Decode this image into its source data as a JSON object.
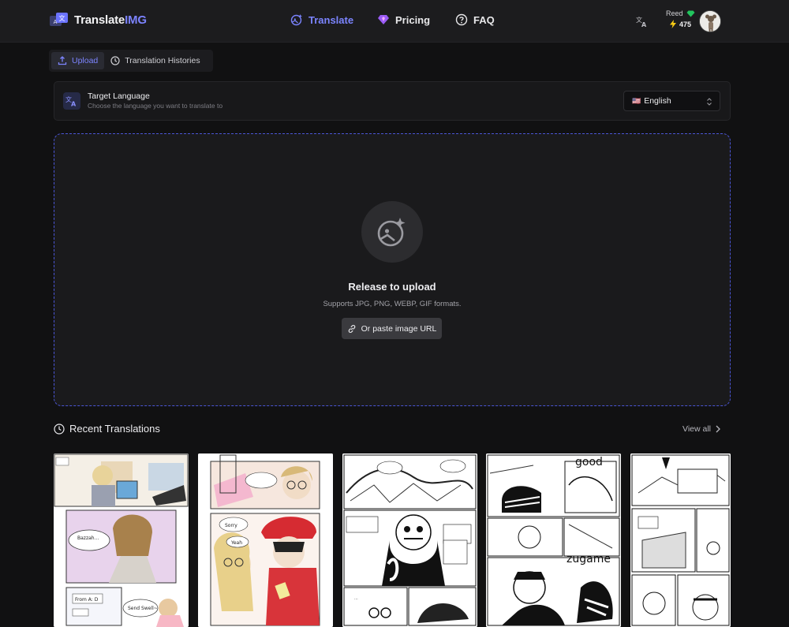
{
  "header": {
    "logo_text": "Translate",
    "logo_accent": "IMG",
    "nav": [
      {
        "label": "Translate",
        "icon": "sparkle-image-icon",
        "active": true
      },
      {
        "label": "Pricing",
        "icon": "diamond-icon",
        "active": false
      },
      {
        "label": "FAQ",
        "icon": "question-circle-icon",
        "active": false
      }
    ],
    "user": {
      "name": "Reed",
      "credits": "475"
    }
  },
  "tabs": [
    {
      "label": "Upload",
      "icon": "upload-icon",
      "active": true
    },
    {
      "label": "Translation Histories",
      "icon": "clock-icon",
      "active": false
    }
  ],
  "target_language": {
    "title": "Target Language",
    "subtitle": "Choose the language you want to translate to",
    "selected": "English",
    "flag": "🇺🇸"
  },
  "dropzone": {
    "title": "Release to upload",
    "subtitle": "Supports JPG, PNG, WEBP, GIF formats.",
    "paste_label": "Or paste image URL"
  },
  "recent": {
    "title": "Recent Translations",
    "view_all": "View all",
    "items": [
      {
        "caption_a": "Bazzah...",
        "caption_b": "Send Swell~",
        "caption_c": "From A: D"
      },
      {
        "caption_a": "Sorry",
        "caption_b": "Yeah"
      },
      {
        "caption_a": "..."
      },
      {
        "caption_a": "good",
        "caption_b": "zugame"
      },
      {
        "caption_a": ""
      }
    ]
  },
  "colors": {
    "accent": "#7b84ff",
    "background": "#111112",
    "panel": "#1c1c1e"
  }
}
